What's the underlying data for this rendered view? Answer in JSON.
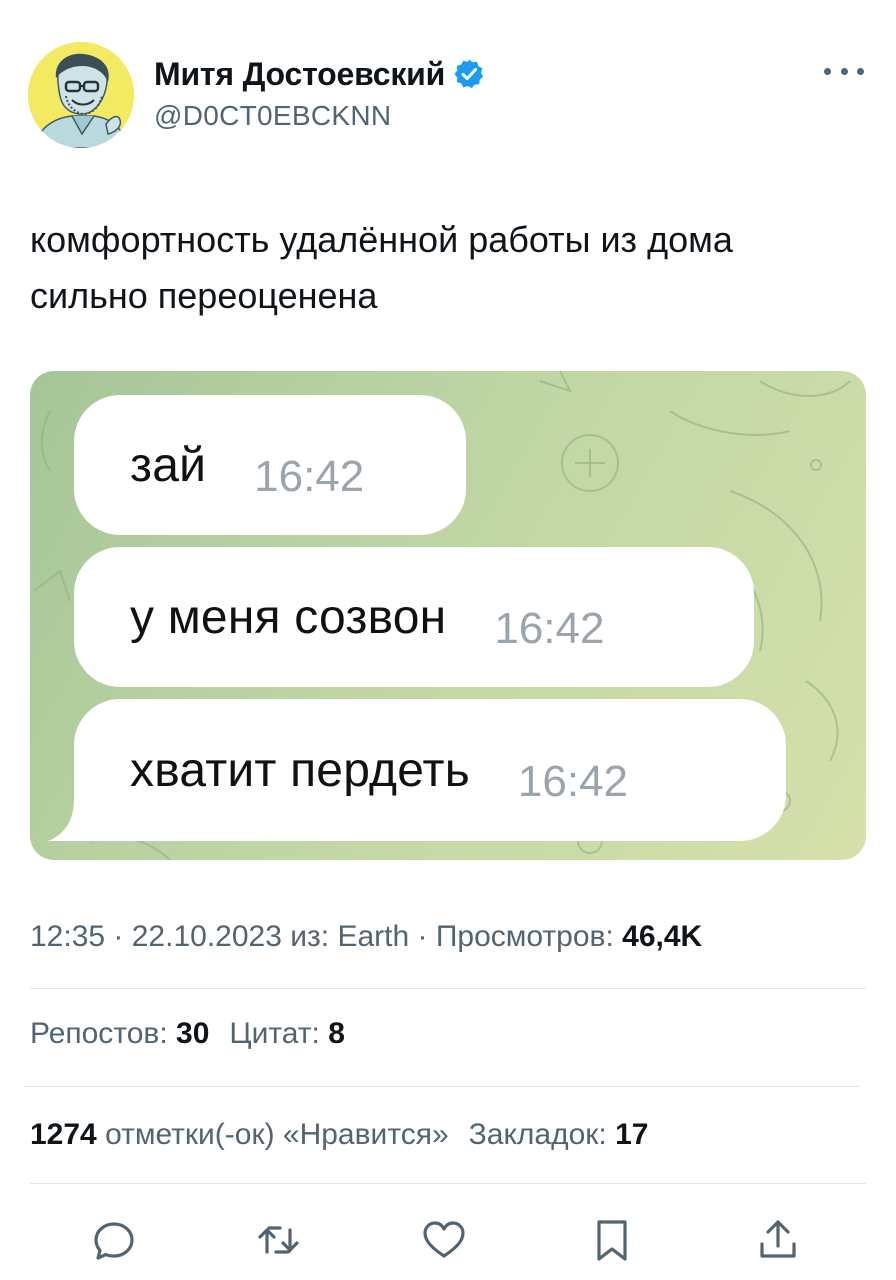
{
  "author": {
    "display_name": "Митя Достоевский",
    "handle": "@D0CT0EBCKNN",
    "verified": true,
    "avatar": "avatar-icon"
  },
  "tweet": {
    "text_line1": "комфортность удалённой работы из дома",
    "text_line2": "сильно переоценена"
  },
  "media": {
    "messages": [
      {
        "text": "зай",
        "time": "16:42"
      },
      {
        "text": "у меня созвон",
        "time": "16:42"
      },
      {
        "text": "хватит пердеть",
        "time": "16:42"
      }
    ]
  },
  "meta": {
    "time": "12:35",
    "sep1": " · ",
    "date": "22.10.2023",
    "source_prefix": " из: ",
    "source": "Earth",
    "sep2": " · ",
    "views_label": "Просмотров: ",
    "views_value": "46,4K"
  },
  "stats": {
    "reposts_label": "Репостов: ",
    "reposts_value": "30",
    "quotes_label": "Цитат: ",
    "quotes_value": "8",
    "likes_value": "1274",
    "likes_label": " отметки(-ок) «Нравится»",
    "bookmarks_label": "Закладок: ",
    "bookmarks_value": "17"
  },
  "actions": [
    "reply-icon",
    "repost-icon",
    "like-icon",
    "bookmark-icon",
    "share-icon"
  ],
  "colors": {
    "text": "#0f1419",
    "secondary": "#536471",
    "verified": "#1d9bf0",
    "divider": "#e1e6ea"
  }
}
